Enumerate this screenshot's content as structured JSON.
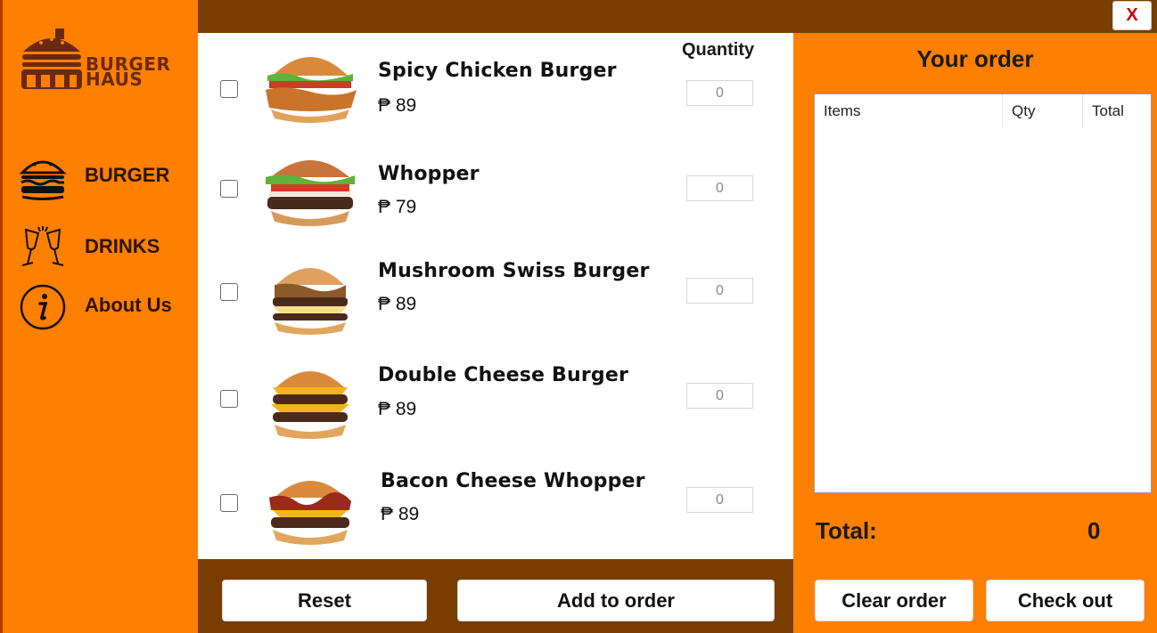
{
  "app": {
    "brand_line1": "BURGER",
    "brand_line2": "HAUS",
    "close_label": "X"
  },
  "sidebar": {
    "items": [
      {
        "label": "BURGER",
        "icon": "burger-icon"
      },
      {
        "label": "DRINKS",
        "icon": "drinks-icon"
      },
      {
        "label": "About Us",
        "icon": "info-icon"
      }
    ]
  },
  "menu": {
    "quantity_header": "Quantity",
    "items": [
      {
        "name": "Spicy Chicken Burger",
        "price": "₱ 89",
        "qty": "0"
      },
      {
        "name": "Whopper",
        "price": "₱ 79",
        "qty": "0"
      },
      {
        "name": "Mushroom Swiss Burger",
        "price": "₱ 89",
        "qty": "0"
      },
      {
        "name": "Double Cheese Burger",
        "price": "₱ 89",
        "qty": "0"
      },
      {
        "name": "Bacon Cheese Whopper",
        "price": "₱ 89",
        "qty": "0"
      }
    ],
    "reset_label": "Reset",
    "add_label": "Add to order"
  },
  "order": {
    "title": "Your order",
    "columns": [
      "Items",
      "Qty",
      "Total"
    ],
    "total_label": "Total:",
    "total_value": "0",
    "clear_label": "Clear order",
    "checkout_label": "Check out"
  },
  "colors": {
    "accent": "#ff7f00",
    "dark_brown": "#7a3d00",
    "close_red": "#d00000"
  }
}
